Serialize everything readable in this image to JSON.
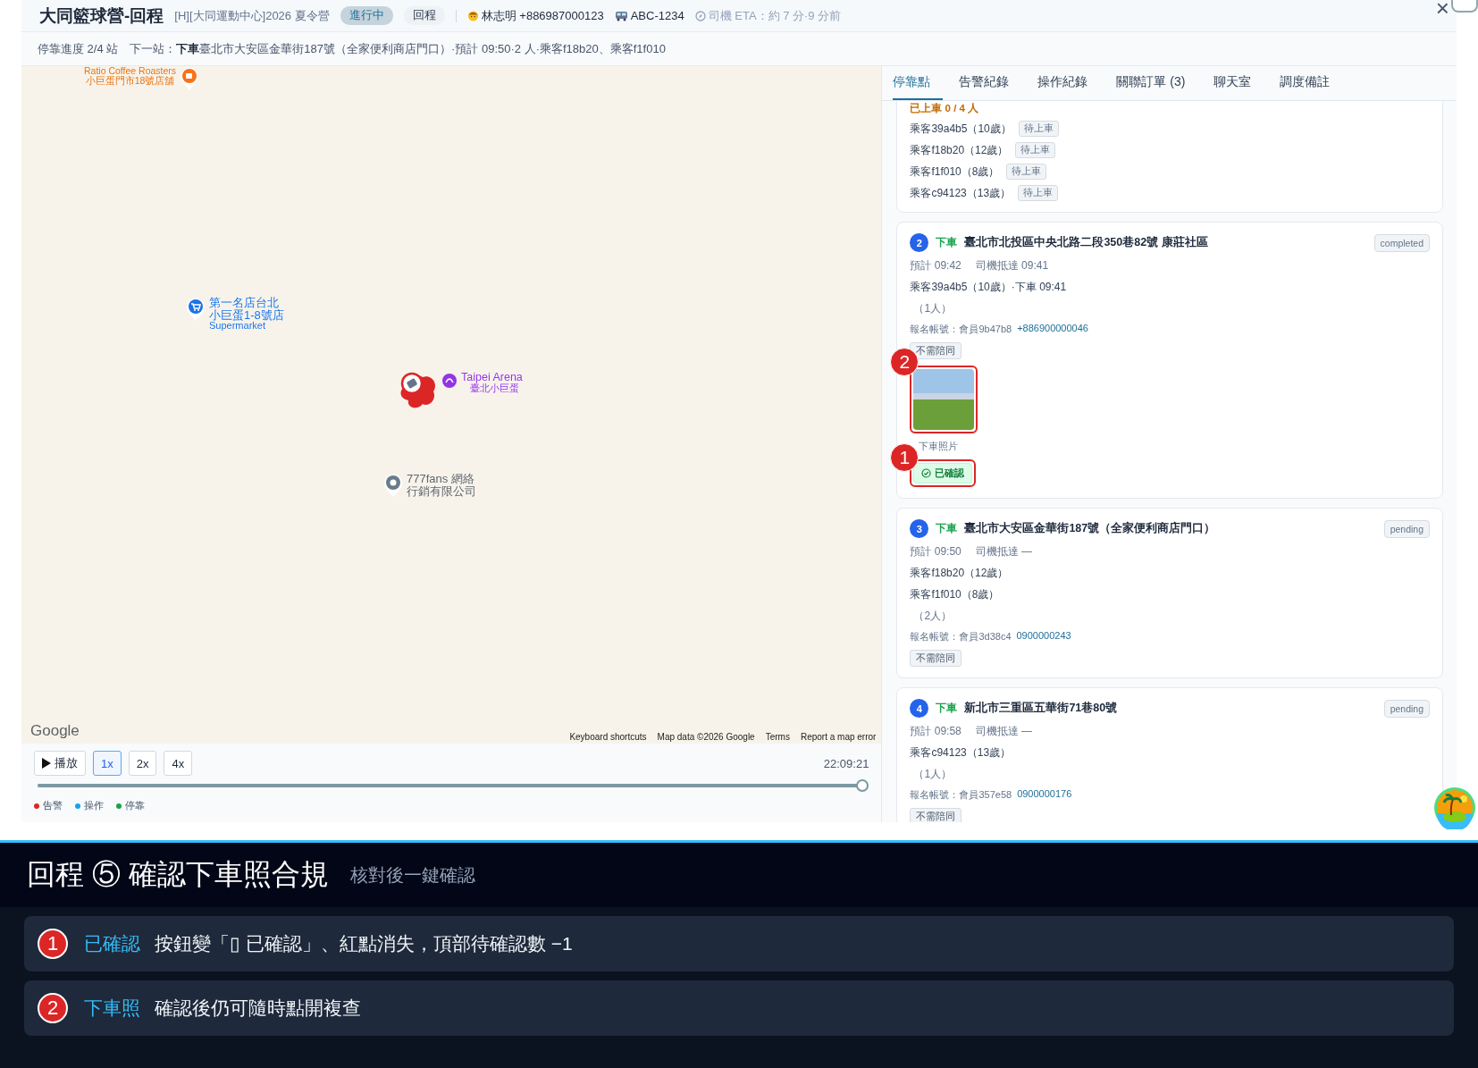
{
  "header": {
    "title": "大同籃球營-回程",
    "subtitle": "[H][大同運動中心]2026 夏令營",
    "badges": [
      {
        "label": "進行中",
        "kind": "status"
      },
      {
        "label": "回程",
        "kind": "direction"
      }
    ],
    "driver": "林志明 +886987000123",
    "vehicle": "ABC-1234",
    "eta": "司機 ETA：約 7 分·9 分前",
    "close": "×"
  },
  "progress": "停靠進度 2/4 站　下一站：**下車** 臺北市大安區金華街187號（全家便利商店門口）·預計 09:50·2 人·乘客f18b20、乘客f1f010",
  "map": {
    "pois": [
      {
        "kind": "cafe",
        "lines": [
          "Ratio Coffee Roasters",
          "小巨蛋門市18號店舖"
        ]
      },
      {
        "kind": "supermarket",
        "lines": [
          "第一名店台北",
          "小巨蛋1-8號店",
          "Supermarket"
        ]
      },
      {
        "kind": "arena",
        "lines": [
          "Taipei Arena",
          "臺北小巨蛋"
        ]
      },
      {
        "kind": "place",
        "lines": [
          "777fans 網絡",
          "行銷有限公司"
        ]
      }
    ],
    "attribution": "Google",
    "footer_links": [
      "Keyboard shortcuts",
      "Map data ©2026 Google",
      "Terms",
      "Report a map error"
    ]
  },
  "playback": {
    "play": "播放",
    "speeds": [
      {
        "label": "1x",
        "selected": true
      },
      {
        "label": "2x",
        "selected": false
      },
      {
        "label": "4x",
        "selected": false
      }
    ],
    "time": "22:09:21",
    "level": 1,
    "legend": [
      {
        "label": "告警",
        "color": "#dc2626"
      },
      {
        "label": "操作",
        "color": "#0ea5e9"
      },
      {
        "label": "停靠",
        "color": "#16a34a"
      }
    ]
  },
  "tabs": [
    {
      "label": "停靠點",
      "selected": true
    },
    {
      "label": "告警紀錄",
      "selected": false
    },
    {
      "label": "操作紀錄",
      "selected": false
    },
    {
      "label": "關聯訂單 (3)",
      "selected": false
    },
    {
      "label": "聊天室",
      "selected": false
    },
    {
      "label": "調度備註",
      "selected": false
    }
  ],
  "boarding": {
    "summary": "已上車 0 / 4 人",
    "passengers": [
      {
        "name": "乘客39a4b5（10歲）",
        "status": "待上車"
      },
      {
        "name": "乘客f18b20（12歲）",
        "status": "待上車"
      },
      {
        "name": "乘客f1f010（8歲）",
        "status": "待上車"
      },
      {
        "name": "乘客c94123（13歲）",
        "status": "待上車"
      }
    ]
  },
  "stops": [
    {
      "number": "2",
      "action": "下車",
      "address": "臺北市北投區中央北路二段350巷82號 康莊社區",
      "status": "completed",
      "planned": "預計 09:42",
      "arrival": "司機抵達 09:41",
      "passengers": [
        "乘客39a4b5（10歲）·下車 09:41"
      ],
      "count": "（1人）",
      "account": "報名帳號：會員9b47b8",
      "phone": "+886900000046",
      "tag": "不需陪同",
      "photo": {
        "caption": "下車照片",
        "callout": "2"
      },
      "confirm": {
        "label": "已確認",
        "confirmed": true,
        "callout": "1"
      }
    },
    {
      "number": "3",
      "action": "下車",
      "address": "臺北市大安區金華街187號（全家便利商店門口）",
      "status": "pending",
      "planned": "預計 09:50",
      "arrival": "司機抵達 —",
      "passengers": [
        "乘客f18b20（12歲）",
        "乘客f1f010（8歲）"
      ],
      "count": "（2人）",
      "account": "報名帳號：會員3d38c4",
      "phone": "0900000243",
      "tag": "不需陪同"
    },
    {
      "number": "4",
      "action": "下車",
      "address": "新北市三重區五華街71巷80號",
      "status": "pending",
      "planned": "預計 09:58",
      "arrival": "司機抵達 —",
      "passengers": [
        "乘客c94123（13歲）"
      ],
      "count": "（1人）",
      "account": "報名帳號：會員357e58",
      "phone": "0900000176",
      "tag": "不需陪同"
    }
  ],
  "guide": {
    "title": "回程 ⑤ 確認下車照合規",
    "subtitle": "核對後一鍵確認",
    "items": [
      {
        "number": "1",
        "term": "已確認",
        "text": "按鈕變「▯ 已確認」、紅點消失，頂部待確認數 −1"
      },
      {
        "number": "2",
        "term": "下車照",
        "text": "確認後仍可隨時點開複查"
      }
    ]
  }
}
